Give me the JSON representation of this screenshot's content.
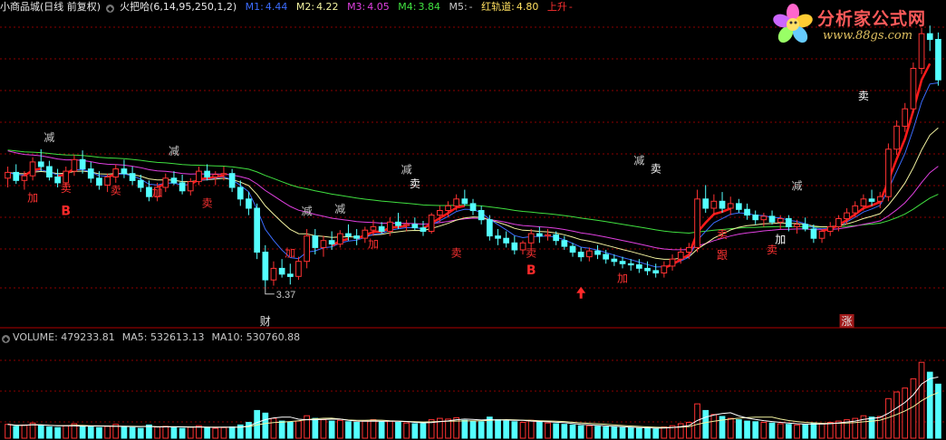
{
  "header": {
    "stock_name": "小商品城(日线 前复权)",
    "indicator_name": "火把哈",
    "indicator_params": "(6,14,95,250,1,2)",
    "m1": {
      "label": "M1:",
      "value": "4.44",
      "color": "#3b6cff"
    },
    "m2": {
      "label": "M2:",
      "value": "4.22",
      "color": "#f2f2a0"
    },
    "m3": {
      "label": "M3:",
      "value": "4.05",
      "color": "#e040e0"
    },
    "m4": {
      "label": "M4:",
      "value": "3.84",
      "color": "#40e040"
    },
    "m5": {
      "label": "M5:",
      "value": "-",
      "color": "#c8c8c8"
    },
    "red_track": {
      "label": "红轨道:",
      "value": "4.80",
      "color": "#ffe060"
    },
    "rising": {
      "label": "上升",
      "value": "-",
      "color": "#ff3030"
    }
  },
  "volume_header": {
    "volume": "VOLUME: 479233.81",
    "ma5": "MA5: 532613.13",
    "ma10": "MA10: 530760.88"
  },
  "logo": {
    "text": "分析家公式网",
    "url": "www.88gs.com"
  },
  "colors": {
    "up": "#ff3232",
    "down": "#54ffff",
    "grid": "#8b0000",
    "ma_blue": "#3b6cff",
    "ma_yellow": "#f2f2a0",
    "ma_magenta": "#e040e0",
    "ma_green": "#40e040",
    "red_line": "#ff1a1a",
    "vol_ma5": "#ffffff",
    "vol_ma10": "#f2f2a0"
  },
  "chart_data": {
    "type": "candlestick",
    "price_range": [
      3.1,
      5.7
    ],
    "min_label": "3.37",
    "ohlc": [
      [
        4.3,
        4.4,
        4.22,
        4.35
      ],
      [
        4.35,
        4.42,
        4.25,
        4.28
      ],
      [
        4.28,
        4.36,
        4.2,
        4.32
      ],
      [
        4.32,
        4.48,
        4.28,
        4.44
      ],
      [
        4.44,
        4.55,
        4.36,
        4.4
      ],
      [
        4.4,
        4.45,
        4.28,
        4.31
      ],
      [
        4.31,
        4.38,
        4.22,
        4.26
      ],
      [
        4.26,
        4.4,
        4.22,
        4.36
      ],
      [
        4.36,
        4.5,
        4.32,
        4.46
      ],
      [
        4.46,
        4.54,
        4.34,
        4.38
      ],
      [
        4.38,
        4.44,
        4.26,
        4.3
      ],
      [
        4.3,
        4.36,
        4.2,
        4.24
      ],
      [
        4.24,
        4.34,
        4.18,
        4.31
      ],
      [
        4.31,
        4.42,
        4.26,
        4.38
      ],
      [
        4.38,
        4.46,
        4.3,
        4.34
      ],
      [
        4.34,
        4.4,
        4.24,
        4.28
      ],
      [
        4.28,
        4.33,
        4.18,
        4.22
      ],
      [
        4.22,
        4.28,
        4.1,
        4.14
      ],
      [
        4.14,
        4.26,
        4.1,
        4.22
      ],
      [
        4.22,
        4.34,
        4.18,
        4.3
      ],
      [
        4.3,
        4.36,
        4.24,
        4.26
      ],
      [
        4.26,
        4.33,
        4.16,
        4.19
      ],
      [
        4.19,
        4.3,
        4.15,
        4.27
      ],
      [
        4.27,
        4.4,
        4.24,
        4.36
      ],
      [
        4.36,
        4.42,
        4.28,
        4.31
      ],
      [
        4.31,
        4.36,
        4.24,
        4.33
      ],
      [
        4.33,
        4.4,
        4.28,
        4.34
      ],
      [
        4.34,
        4.38,
        4.18,
        4.22
      ],
      [
        4.22,
        4.28,
        4.06,
        4.12
      ],
      [
        4.12,
        4.18,
        3.98,
        4.04
      ],
      [
        4.04,
        4.08,
        3.6,
        3.66
      ],
      [
        3.66,
        3.72,
        3.36,
        3.42
      ],
      [
        3.42,
        3.58,
        3.37,
        3.52
      ],
      [
        3.52,
        3.6,
        3.44,
        3.47
      ],
      [
        3.47,
        3.56,
        3.38,
        3.45
      ],
      [
        3.45,
        3.62,
        3.42,
        3.58
      ],
      [
        3.58,
        3.86,
        3.52,
        3.8
      ],
      [
        3.8,
        3.86,
        3.64,
        3.7
      ],
      [
        3.7,
        3.8,
        3.62,
        3.76
      ],
      [
        3.76,
        3.84,
        3.68,
        3.73
      ],
      [
        3.73,
        3.85,
        3.7,
        3.82
      ],
      [
        3.82,
        3.9,
        3.76,
        3.8
      ],
      [
        3.8,
        3.86,
        3.72,
        3.78
      ],
      [
        3.78,
        3.88,
        3.74,
        3.85
      ],
      [
        3.85,
        3.94,
        3.8,
        3.88
      ],
      [
        3.88,
        3.92,
        3.82,
        3.84
      ],
      [
        3.84,
        3.96,
        3.8,
        3.92
      ],
      [
        3.92,
        4.0,
        3.86,
        3.89
      ],
      [
        3.89,
        3.94,
        3.84,
        3.9
      ],
      [
        3.9,
        3.96,
        3.85,
        3.87
      ],
      [
        3.87,
        3.93,
        3.8,
        3.84
      ],
      [
        3.84,
        4.0,
        3.82,
        3.98
      ],
      [
        3.98,
        4.06,
        3.92,
        4.02
      ],
      [
        4.02,
        4.1,
        3.96,
        4.06
      ],
      [
        4.06,
        4.16,
        4.02,
        4.12
      ],
      [
        4.12,
        4.2,
        4.06,
        4.08
      ],
      [
        4.08,
        4.12,
        3.98,
        4.02
      ],
      [
        4.02,
        4.06,
        3.9,
        3.94
      ],
      [
        3.94,
        3.98,
        3.76,
        3.8
      ],
      [
        3.8,
        3.86,
        3.72,
        3.78
      ],
      [
        3.78,
        3.84,
        3.7,
        3.74
      ],
      [
        3.74,
        3.8,
        3.64,
        3.68
      ],
      [
        3.68,
        3.76,
        3.64,
        3.74
      ],
      [
        3.74,
        3.86,
        3.7,
        3.82
      ],
      [
        3.82,
        3.88,
        3.74,
        3.8
      ],
      [
        3.8,
        3.86,
        3.76,
        3.81
      ],
      [
        3.81,
        3.84,
        3.72,
        3.76
      ],
      [
        3.76,
        3.8,
        3.68,
        3.71
      ],
      [
        3.71,
        3.74,
        3.62,
        3.66
      ],
      [
        3.66,
        3.7,
        3.58,
        3.62
      ],
      [
        3.62,
        3.7,
        3.58,
        3.67
      ],
      [
        3.67,
        3.72,
        3.6,
        3.64
      ],
      [
        3.64,
        3.68,
        3.56,
        3.6
      ],
      [
        3.6,
        3.64,
        3.54,
        3.58
      ],
      [
        3.58,
        3.62,
        3.52,
        3.56
      ],
      [
        3.56,
        3.6,
        3.5,
        3.55
      ],
      [
        3.55,
        3.6,
        3.48,
        3.52
      ],
      [
        3.52,
        3.58,
        3.46,
        3.5
      ],
      [
        3.5,
        3.56,
        3.44,
        3.48
      ],
      [
        3.48,
        3.58,
        3.44,
        3.54
      ],
      [
        3.54,
        3.64,
        3.5,
        3.6
      ],
      [
        3.6,
        3.7,
        3.56,
        3.66
      ],
      [
        3.66,
        3.74,
        3.6,
        3.7
      ],
      [
        3.7,
        4.2,
        3.66,
        4.12
      ],
      [
        4.12,
        4.24,
        4.0,
        4.04
      ],
      [
        4.04,
        4.16,
        3.98,
        4.1
      ],
      [
        4.1,
        4.18,
        4.0,
        4.04
      ],
      [
        4.04,
        4.14,
        3.98,
        4.08
      ],
      [
        4.08,
        4.12,
        4.0,
        4.03
      ],
      [
        4.03,
        4.08,
        3.94,
        3.98
      ],
      [
        3.98,
        4.02,
        3.9,
        3.94
      ],
      [
        3.94,
        4.0,
        3.88,
        3.97
      ],
      [
        3.97,
        4.02,
        3.9,
        3.92
      ],
      [
        3.92,
        3.98,
        3.86,
        3.95
      ],
      [
        3.95,
        3.98,
        3.84,
        3.88
      ],
      [
        3.88,
        3.94,
        3.82,
        3.9
      ],
      [
        3.9,
        3.96,
        3.84,
        3.86
      ],
      [
        3.86,
        3.9,
        3.74,
        3.78
      ],
      [
        3.78,
        3.86,
        3.74,
        3.84
      ],
      [
        3.84,
        3.92,
        3.8,
        3.88
      ],
      [
        3.88,
        3.98,
        3.84,
        3.95
      ],
      [
        3.95,
        4.04,
        3.9,
        4.0
      ],
      [
        4.0,
        4.1,
        3.96,
        4.06
      ],
      [
        4.06,
        4.16,
        4.02,
        4.12
      ],
      [
        4.12,
        4.2,
        4.06,
        4.1
      ],
      [
        4.1,
        4.18,
        4.04,
        4.14
      ],
      [
        4.14,
        4.6,
        4.1,
        4.55
      ],
      [
        4.55,
        4.8,
        4.5,
        4.75
      ],
      [
        4.75,
        4.95,
        4.7,
        4.9
      ],
      [
        4.9,
        5.3,
        4.86,
        5.25
      ],
      [
        5.25,
        5.6,
        5.2,
        5.55
      ],
      [
        5.55,
        5.62,
        5.4,
        5.5
      ],
      [
        5.5,
        5.56,
        5.1,
        5.15
      ]
    ],
    "volume_max": 1400000,
    "volume": [
      210000,
      180000,
      200000,
      230000,
      190000,
      170000,
      160000,
      190000,
      220000,
      180000,
      170000,
      160000,
      180000,
      210000,
      170000,
      160000,
      150000,
      200000,
      170000,
      180000,
      160000,
      150000,
      170000,
      190000,
      160000,
      150000,
      160000,
      170000,
      200000,
      240000,
      420000,
      380000,
      300000,
      260000,
      240000,
      260000,
      340000,
      300000,
      280000,
      260000,
      270000,
      250000,
      240000,
      260000,
      280000,
      250000,
      260000,
      240000,
      230000,
      220000,
      220000,
      280000,
      300000,
      290000,
      310000,
      270000,
      260000,
      250000,
      320000,
      280000,
      260000,
      250000,
      240000,
      270000,
      250000,
      230000,
      220000,
      210000,
      200000,
      190000,
      190000,
      180000,
      170000,
      170000,
      160000,
      160000,
      150000,
      150000,
      140000,
      170000,
      190000,
      220000,
      240000,
      520000,
      420000,
      360000,
      330000,
      300000,
      280000,
      260000,
      250000,
      240000,
      230000,
      220000,
      210000,
      200000,
      210000,
      230000,
      220000,
      240000,
      260000,
      280000,
      300000,
      340000,
      320000,
      330000,
      600000,
      700000,
      760000,
      900000,
      1150000,
      1000000,
      820000
    ],
    "markers": [
      {
        "bar": 5,
        "text": "减",
        "color": "#c8c8c8",
        "pos": "above",
        "level": 4.62
      },
      {
        "bar": 3,
        "text": "加",
        "color": "#ff3232",
        "pos": "below",
        "level": 4.1
      },
      {
        "bar": 7,
        "text": "卖",
        "color": "#ff3232",
        "pos": "below",
        "level": 4.18
      },
      {
        "bar": 13,
        "text": "卖",
        "color": "#ff3232",
        "pos": "below",
        "level": 4.16
      },
      {
        "bar": 18,
        "text": "加",
        "color": "#ff3232",
        "pos": "below",
        "level": 4.14
      },
      {
        "bar": 20,
        "text": "减",
        "color": "#c8c8c8",
        "pos": "above",
        "level": 4.5
      },
      {
        "bar": 24,
        "text": "卖",
        "color": "#ff3232",
        "pos": "below",
        "level": 4.05
      },
      {
        "bar": 34,
        "text": "加",
        "color": "#ff3232",
        "pos": "below",
        "level": 3.62
      },
      {
        "bar": 36,
        "text": "减",
        "color": "#c8c8c8",
        "pos": "above",
        "level": 3.98
      },
      {
        "bar": 40,
        "text": "减",
        "color": "#c8c8c8",
        "pos": "above",
        "level": 4.0
      },
      {
        "bar": 44,
        "text": "加",
        "color": "#ff3232",
        "pos": "below",
        "level": 3.7
      },
      {
        "bar": 48,
        "text": "减",
        "color": "#c8c8c8",
        "pos": "above",
        "level": 4.34
      },
      {
        "bar": 49,
        "text": "卖",
        "color": "#ffffff",
        "pos": "above",
        "level": 4.22
      },
      {
        "bar": 54,
        "text": "卖",
        "color": "#ff3232",
        "pos": "below",
        "level": 3.62
      },
      {
        "bar": 63,
        "text": "卖",
        "color": "#ff3232",
        "pos": "below",
        "level": 3.62
      },
      {
        "bar": 74,
        "text": "加",
        "color": "#ff3232",
        "pos": "below",
        "level": 3.4
      },
      {
        "bar": 76,
        "text": "减",
        "color": "#c8c8c8",
        "pos": "above",
        "level": 4.42
      },
      {
        "bar": 78,
        "text": "卖",
        "color": "#ffffff",
        "pos": "above",
        "level": 4.35
      },
      {
        "bar": 86,
        "text": "卖",
        "color": "#ff3232",
        "pos": "below",
        "level": 3.78
      },
      {
        "bar": 86,
        "text": "跟",
        "color": "#ff3232",
        "pos": "below",
        "level": 3.6
      },
      {
        "bar": 92,
        "text": "卖",
        "color": "#ff3232",
        "pos": "below",
        "level": 3.65
      },
      {
        "bar": 93,
        "text": "加",
        "color": "#ffffff",
        "pos": "below",
        "level": 3.74
      },
      {
        "bar": 95,
        "text": "减",
        "color": "#c8c8c8",
        "pos": "above",
        "level": 4.2
      },
      {
        "bar": 103,
        "text": "卖",
        "color": "#ffffff",
        "pos": "above",
        "level": 4.98
      }
    ],
    "b_labels": [
      {
        "bar": 7,
        "text": "B",
        "level": 3.98
      },
      {
        "bar": 63,
        "text": "B",
        "level": 3.47
      }
    ],
    "arrow": {
      "bar": 69,
      "level": 3.36
    },
    "bottom_tags": [
      {
        "bar": 31,
        "text": "财"
      },
      {
        "bar": 101,
        "text": "涨"
      }
    ]
  }
}
